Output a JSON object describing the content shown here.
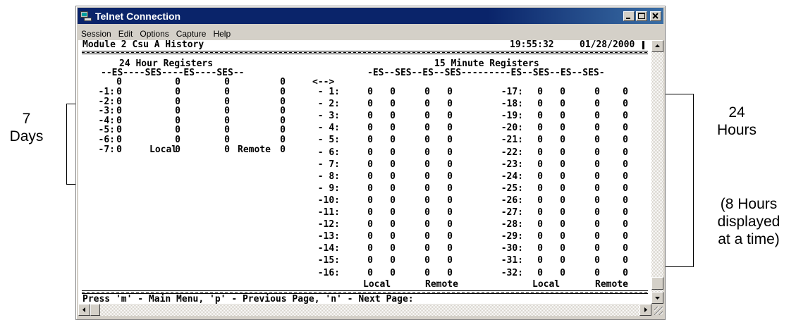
{
  "window": {
    "title": "Telnet Connection",
    "app_icon": "telnet-terminal-icon",
    "buttons": [
      "minimize-icon",
      "maximize-icon",
      "close-icon"
    ],
    "titlebar_color": "#0a246a"
  },
  "menubar": {
    "items": [
      "Session",
      "Edit",
      "Options",
      "Capture",
      "Help"
    ]
  },
  "terminal": {
    "header_title": "Module 2 Csu A History",
    "time": "19:55:32",
    "date": "01/28/2000",
    "h24_title": "24 Hour Registers",
    "h24_columns": "--ES----SES----ES----SES--",
    "m15_title": "15 Minute Registers",
    "m15_columns": "-ES--SES--ES--SES---------ES--SES--ES--SES-",
    "nav_arrows": "<-->",
    "h24_current_row": [
      "0",
      "0",
      "0",
      "0"
    ],
    "h24_rows": [
      {
        "label": "-1:",
        "values": [
          "0",
          "0",
          "0",
          "0"
        ]
      },
      {
        "label": "-2:",
        "values": [
          "0",
          "0",
          "0",
          "0"
        ]
      },
      {
        "label": "-3:",
        "values": [
          "0",
          "0",
          "0",
          "0"
        ]
      },
      {
        "label": "-4:",
        "values": [
          "0",
          "0",
          "0",
          "0"
        ]
      },
      {
        "label": "-5:",
        "values": [
          "0",
          "0",
          "0",
          "0"
        ]
      },
      {
        "label": "-6:",
        "values": [
          "0",
          "0",
          "0",
          "0"
        ]
      },
      {
        "label": "-7:",
        "values": [
          "0",
          "0",
          "0",
          "0"
        ]
      }
    ],
    "h24_footer_local": "Local",
    "h24_footer_remote": "Remote",
    "m15_rows": [
      {
        "left_label": "- 1:",
        "left": [
          "0",
          "0",
          "0",
          "0"
        ],
        "right_label": "-17:",
        "right": [
          "0",
          "0",
          "0",
          "0"
        ]
      },
      {
        "left_label": "- 2:",
        "left": [
          "0",
          "0",
          "0",
          "0"
        ],
        "right_label": "-18:",
        "right": [
          "0",
          "0",
          "0",
          "0"
        ]
      },
      {
        "left_label": "- 3:",
        "left": [
          "0",
          "0",
          "0",
          "0"
        ],
        "right_label": "-19:",
        "right": [
          "0",
          "0",
          "0",
          "0"
        ]
      },
      {
        "left_label": "- 4:",
        "left": [
          "0",
          "0",
          "0",
          "0"
        ],
        "right_label": "-20:",
        "right": [
          "0",
          "0",
          "0",
          "0"
        ]
      },
      {
        "left_label": "- 5:",
        "left": [
          "0",
          "0",
          "0",
          "0"
        ],
        "right_label": "-21:",
        "right": [
          "0",
          "0",
          "0",
          "0"
        ]
      },
      {
        "left_label": "- 6:",
        "left": [
          "0",
          "0",
          "0",
          "0"
        ],
        "right_label": "-22:",
        "right": [
          "0",
          "0",
          "0",
          "0"
        ]
      },
      {
        "left_label": "- 7:",
        "left": [
          "0",
          "0",
          "0",
          "0"
        ],
        "right_label": "-23:",
        "right": [
          "0",
          "0",
          "0",
          "0"
        ]
      },
      {
        "left_label": "- 8:",
        "left": [
          "0",
          "0",
          "0",
          "0"
        ],
        "right_label": "-24:",
        "right": [
          "0",
          "0",
          "0",
          "0"
        ]
      },
      {
        "left_label": "- 9:",
        "left": [
          "0",
          "0",
          "0",
          "0"
        ],
        "right_label": "-25:",
        "right": [
          "0",
          "0",
          "0",
          "0"
        ]
      },
      {
        "left_label": "-10:",
        "left": [
          "0",
          "0",
          "0",
          "0"
        ],
        "right_label": "-26:",
        "right": [
          "0",
          "0",
          "0",
          "0"
        ]
      },
      {
        "left_label": "-11:",
        "left": [
          "0",
          "0",
          "0",
          "0"
        ],
        "right_label": "-27:",
        "right": [
          "0",
          "0",
          "0",
          "0"
        ]
      },
      {
        "left_label": "-12:",
        "left": [
          "0",
          "0",
          "0",
          "0"
        ],
        "right_label": "-28:",
        "right": [
          "0",
          "0",
          "0",
          "0"
        ]
      },
      {
        "left_label": "-13:",
        "left": [
          "0",
          "0",
          "0",
          "0"
        ],
        "right_label": "-29:",
        "right": [
          "0",
          "0",
          "0",
          "0"
        ]
      },
      {
        "left_label": "-14:",
        "left": [
          "0",
          "0",
          "0",
          "0"
        ],
        "right_label": "-30:",
        "right": [
          "0",
          "0",
          "0",
          "0"
        ]
      },
      {
        "left_label": "-15:",
        "left": [
          "0",
          "0",
          "0",
          "0"
        ],
        "right_label": "-31:",
        "right": [
          "0",
          "0",
          "0",
          "0"
        ]
      },
      {
        "left_label": "-16:",
        "left": [
          "0",
          "0",
          "0",
          "0"
        ],
        "right_label": "-32:",
        "right": [
          "0",
          "0",
          "0",
          "0"
        ]
      }
    ],
    "m15_footer_local": "Local",
    "m15_footer_remote": "Remote",
    "prompt": "Press 'm' - Main Menu, 'p' - Previous Page, 'n' - Next Page:"
  },
  "annotations": {
    "days": "7\nDays",
    "hours": "24\nHours",
    "hours_note": "(8 Hours\ndisplayed\nat a time)"
  }
}
